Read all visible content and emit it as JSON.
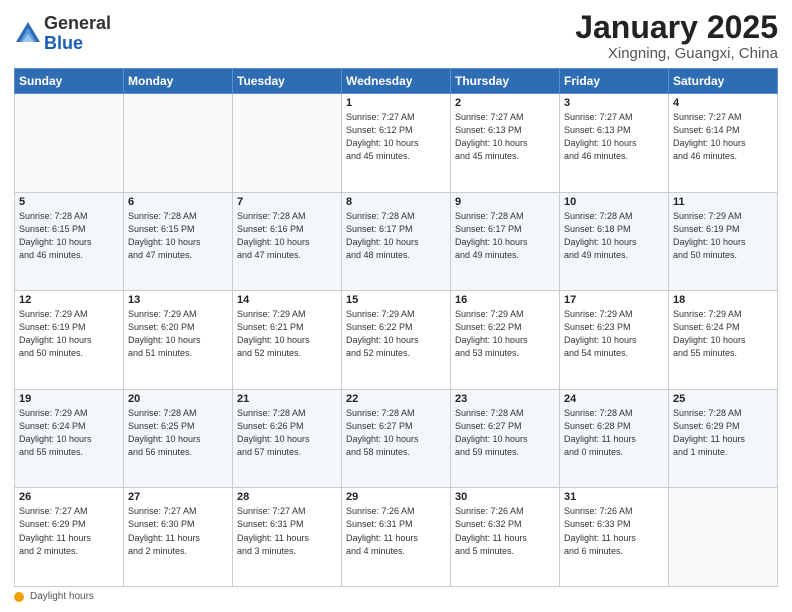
{
  "header": {
    "logo_general": "General",
    "logo_blue": "Blue",
    "month_title": "January 2025",
    "location": "Xingning, Guangxi, China"
  },
  "days_of_week": [
    "Sunday",
    "Monday",
    "Tuesday",
    "Wednesday",
    "Thursday",
    "Friday",
    "Saturday"
  ],
  "weeks": [
    [
      {
        "num": "",
        "info": ""
      },
      {
        "num": "",
        "info": ""
      },
      {
        "num": "",
        "info": ""
      },
      {
        "num": "1",
        "info": "Sunrise: 7:27 AM\nSunset: 6:12 PM\nDaylight: 10 hours\nand 45 minutes."
      },
      {
        "num": "2",
        "info": "Sunrise: 7:27 AM\nSunset: 6:13 PM\nDaylight: 10 hours\nand 45 minutes."
      },
      {
        "num": "3",
        "info": "Sunrise: 7:27 AM\nSunset: 6:13 PM\nDaylight: 10 hours\nand 46 minutes."
      },
      {
        "num": "4",
        "info": "Sunrise: 7:27 AM\nSunset: 6:14 PM\nDaylight: 10 hours\nand 46 minutes."
      }
    ],
    [
      {
        "num": "5",
        "info": "Sunrise: 7:28 AM\nSunset: 6:15 PM\nDaylight: 10 hours\nand 46 minutes."
      },
      {
        "num": "6",
        "info": "Sunrise: 7:28 AM\nSunset: 6:15 PM\nDaylight: 10 hours\nand 47 minutes."
      },
      {
        "num": "7",
        "info": "Sunrise: 7:28 AM\nSunset: 6:16 PM\nDaylight: 10 hours\nand 47 minutes."
      },
      {
        "num": "8",
        "info": "Sunrise: 7:28 AM\nSunset: 6:17 PM\nDaylight: 10 hours\nand 48 minutes."
      },
      {
        "num": "9",
        "info": "Sunrise: 7:28 AM\nSunset: 6:17 PM\nDaylight: 10 hours\nand 49 minutes."
      },
      {
        "num": "10",
        "info": "Sunrise: 7:28 AM\nSunset: 6:18 PM\nDaylight: 10 hours\nand 49 minutes."
      },
      {
        "num": "11",
        "info": "Sunrise: 7:29 AM\nSunset: 6:19 PM\nDaylight: 10 hours\nand 50 minutes."
      }
    ],
    [
      {
        "num": "12",
        "info": "Sunrise: 7:29 AM\nSunset: 6:19 PM\nDaylight: 10 hours\nand 50 minutes."
      },
      {
        "num": "13",
        "info": "Sunrise: 7:29 AM\nSunset: 6:20 PM\nDaylight: 10 hours\nand 51 minutes."
      },
      {
        "num": "14",
        "info": "Sunrise: 7:29 AM\nSunset: 6:21 PM\nDaylight: 10 hours\nand 52 minutes."
      },
      {
        "num": "15",
        "info": "Sunrise: 7:29 AM\nSunset: 6:22 PM\nDaylight: 10 hours\nand 52 minutes."
      },
      {
        "num": "16",
        "info": "Sunrise: 7:29 AM\nSunset: 6:22 PM\nDaylight: 10 hours\nand 53 minutes."
      },
      {
        "num": "17",
        "info": "Sunrise: 7:29 AM\nSunset: 6:23 PM\nDaylight: 10 hours\nand 54 minutes."
      },
      {
        "num": "18",
        "info": "Sunrise: 7:29 AM\nSunset: 6:24 PM\nDaylight: 10 hours\nand 55 minutes."
      }
    ],
    [
      {
        "num": "19",
        "info": "Sunrise: 7:29 AM\nSunset: 6:24 PM\nDaylight: 10 hours\nand 55 minutes."
      },
      {
        "num": "20",
        "info": "Sunrise: 7:28 AM\nSunset: 6:25 PM\nDaylight: 10 hours\nand 56 minutes."
      },
      {
        "num": "21",
        "info": "Sunrise: 7:28 AM\nSunset: 6:26 PM\nDaylight: 10 hours\nand 57 minutes."
      },
      {
        "num": "22",
        "info": "Sunrise: 7:28 AM\nSunset: 6:27 PM\nDaylight: 10 hours\nand 58 minutes."
      },
      {
        "num": "23",
        "info": "Sunrise: 7:28 AM\nSunset: 6:27 PM\nDaylight: 10 hours\nand 59 minutes."
      },
      {
        "num": "24",
        "info": "Sunrise: 7:28 AM\nSunset: 6:28 PM\nDaylight: 11 hours\nand 0 minutes."
      },
      {
        "num": "25",
        "info": "Sunrise: 7:28 AM\nSunset: 6:29 PM\nDaylight: 11 hours\nand 1 minute."
      }
    ],
    [
      {
        "num": "26",
        "info": "Sunrise: 7:27 AM\nSunset: 6:29 PM\nDaylight: 11 hours\nand 2 minutes."
      },
      {
        "num": "27",
        "info": "Sunrise: 7:27 AM\nSunset: 6:30 PM\nDaylight: 11 hours\nand 2 minutes."
      },
      {
        "num": "28",
        "info": "Sunrise: 7:27 AM\nSunset: 6:31 PM\nDaylight: 11 hours\nand 3 minutes."
      },
      {
        "num": "29",
        "info": "Sunrise: 7:26 AM\nSunset: 6:31 PM\nDaylight: 11 hours\nand 4 minutes."
      },
      {
        "num": "30",
        "info": "Sunrise: 7:26 AM\nSunset: 6:32 PM\nDaylight: 11 hours\nand 5 minutes."
      },
      {
        "num": "31",
        "info": "Sunrise: 7:26 AM\nSunset: 6:33 PM\nDaylight: 11 hours\nand 6 minutes."
      },
      {
        "num": "",
        "info": ""
      }
    ]
  ],
  "footer": {
    "daylight_label": "Daylight hours"
  }
}
